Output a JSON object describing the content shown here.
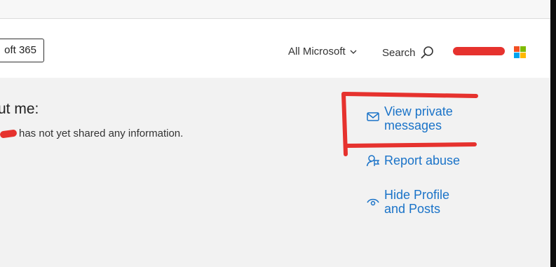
{
  "header": {
    "m365_label": "oft 365",
    "all_microsoft": "All Microsoft",
    "search": "Search"
  },
  "about": {
    "title": "ut me:",
    "text": "has not yet shared any information."
  },
  "actions": {
    "private_messages": [
      "View private",
      "messages"
    ],
    "report_abuse": "Report abuse",
    "hide_profile": [
      "Hide Profile",
      "and Posts"
    ]
  },
  "colors": {
    "link": "#1a73c8",
    "annotation_red": "#e6322e",
    "ms_red": "#f25022",
    "ms_green": "#7fba00",
    "ms_blue": "#00a4ef",
    "ms_yellow": "#ffb900"
  },
  "icons": [
    "chevron-down-icon",
    "search-icon",
    "envelope-icon",
    "report-person-icon",
    "eye-icon",
    "microsoft-logo"
  ]
}
